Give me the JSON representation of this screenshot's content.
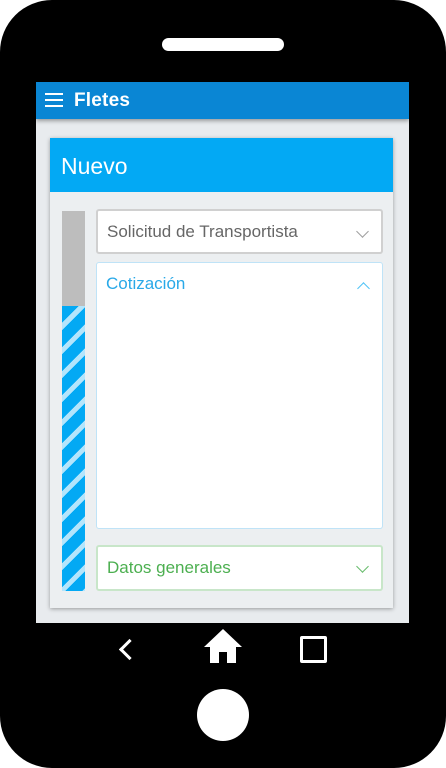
{
  "appbar": {
    "title": "Fletes",
    "menu_icon": "hamburger-menu-icon"
  },
  "card": {
    "title": "Nuevo"
  },
  "progress": {
    "fraction": 0.75,
    "fill_color": "#03a9f4",
    "track_color": "#bdbdbd"
  },
  "panels": [
    {
      "label": "Solicitud de Transportista",
      "state": "collapsed",
      "color": "#666666"
    },
    {
      "label": "Cotización",
      "state": "expanded",
      "color": "#29a9e8"
    },
    {
      "label": "Datos generales",
      "state": "collapsed",
      "color": "#4caf50"
    }
  ],
  "system_nav": {
    "back": "back-icon",
    "home": "home-icon",
    "recent": "recent-apps-icon"
  },
  "colors": {
    "appbar": "#0a86d4",
    "card_header": "#03a9f4",
    "device": "#000000"
  }
}
